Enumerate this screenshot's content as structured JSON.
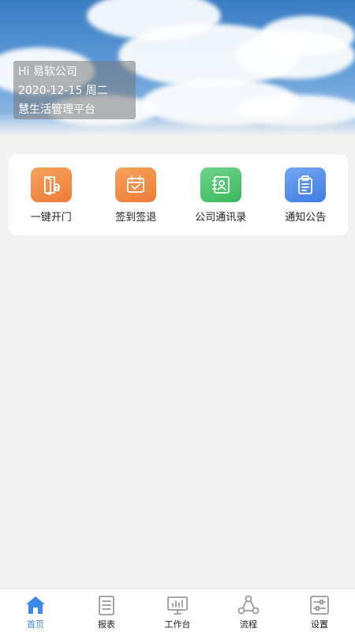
{
  "banner": {
    "greeting": "Hi 易软公司",
    "date": "2020-12-15 周二",
    "platform": "慧生活管理平台"
  },
  "actions": [
    {
      "label": "一键开门",
      "icon": "door-icon",
      "color": "#f0894a"
    },
    {
      "label": "签到签退",
      "icon": "calendar-check-icon",
      "color": "#f0894a"
    },
    {
      "label": "公司通讯录",
      "icon": "contacts-icon",
      "color": "#4bc36a"
    },
    {
      "label": "通知公告",
      "icon": "clipboard-icon",
      "color": "#4f8be8"
    }
  ],
  "tabs": [
    {
      "label": "首页",
      "icon": "home-icon",
      "active": true
    },
    {
      "label": "报表",
      "icon": "report-icon",
      "active": false
    },
    {
      "label": "工作台",
      "icon": "monitor-icon",
      "active": false
    },
    {
      "label": "流程",
      "icon": "flow-icon",
      "active": false
    },
    {
      "label": "设置",
      "icon": "settings-icon",
      "active": false
    }
  ],
  "colors": {
    "accent": "#3b8be6",
    "background": "#f2f2f2"
  }
}
